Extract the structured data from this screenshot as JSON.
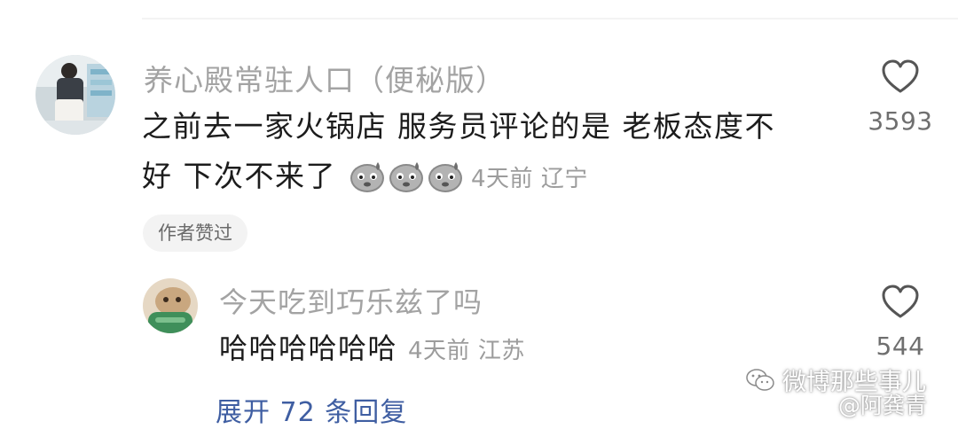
{
  "comment": {
    "username": "养心殿常驻人口（便秘版）",
    "text_line1": "之前去一家火锅店 服务员评论的是 老板态度不",
    "text_line2": "好  下次不来了",
    "time": "4天前",
    "location": "辽宁",
    "like_count": "3593",
    "author_badge": "作者赞过",
    "emoji_names": [
      "sweat-face-emoji",
      "sweat-face-emoji",
      "sweat-face-emoji"
    ]
  },
  "reply": {
    "username": "今天吃到巧乐兹了吗",
    "text": "哈哈哈哈哈哈",
    "time": "4天前",
    "location": "江苏",
    "like_count": "544"
  },
  "expand_label": "展开 72 条回复",
  "watermark": {
    "line1": "微博那些事儿",
    "line2": "@阿龚青"
  },
  "icons": {
    "like": "heart-outline-icon",
    "watermark": "wechat-icon"
  },
  "colors": {
    "link": "#3f5ea2",
    "muted_text": "#a3a3a3",
    "body_text": "#1c1c1c",
    "badge_bg": "#f3f3f3"
  }
}
